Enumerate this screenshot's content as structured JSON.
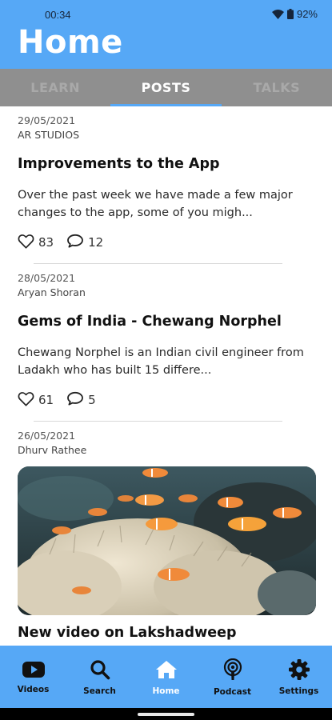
{
  "status_bar": {
    "time": "00:34",
    "battery": "92%"
  },
  "header": {
    "title": "Home"
  },
  "tabs": [
    {
      "label": "LEARN",
      "active": false
    },
    {
      "label": "POSTS",
      "active": true
    },
    {
      "label": "TALKS",
      "active": false
    }
  ],
  "posts": [
    {
      "date": "29/05/2021",
      "author": "AR STUDIOS",
      "title": "Improvements to the App",
      "excerpt": "Over the past week we have made a few major changes to the app, some of you migh...",
      "likes": "83",
      "comments": "12"
    },
    {
      "date": "28/05/2021",
      "author": "Aryan Shoran",
      "title": "Gems of India - Chewang Norphel",
      "excerpt": "Chewang Norphel is an Indian civil engineer from Ladakh who has built 15 differe...",
      "likes": "61",
      "comments": "5"
    },
    {
      "date": "26/05/2021",
      "author": "Dhurv Rathee",
      "title": "New video on Lakshadweep",
      "image": "clownfish-anemone-reef-photo"
    }
  ],
  "bottom_nav": [
    {
      "label": "Videos",
      "icon": "youtube-icon",
      "active": false
    },
    {
      "label": "Search",
      "icon": "search-icon",
      "active": false
    },
    {
      "label": "Home",
      "icon": "home-icon",
      "active": true
    },
    {
      "label": "Podcast",
      "icon": "podcast-icon",
      "active": false
    },
    {
      "label": "Settings",
      "icon": "gear-icon",
      "active": false
    }
  ],
  "colors": {
    "primary": "#56a8f6",
    "tab_bar": "#8f8f8f",
    "inactive_tab": "#a9a9a9",
    "active_text": "#ffffff"
  }
}
